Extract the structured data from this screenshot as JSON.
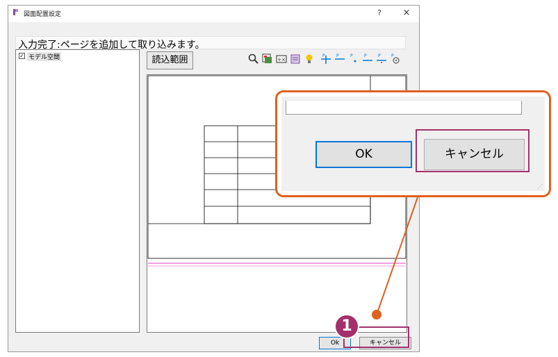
{
  "window": {
    "title": "図面配置設定",
    "help_label": "?",
    "close_label": "×"
  },
  "status": {
    "message": "入力完了:ページを追加して取り込みます。"
  },
  "tree": {
    "items": [
      {
        "label": "モデル空間",
        "checked": true
      }
    ]
  },
  "toolbar": {
    "range_button_label": "読込範囲",
    "icons": [
      "zoom-icon",
      "select-icon",
      "frame-icon",
      "layers-icon",
      "lightbulb-icon",
      "page-add-icon",
      "page-minus-icon",
      "page-point-icon",
      "page-line-icon",
      "page-dotline-icon",
      "page-circle-icon"
    ]
  },
  "footer": {
    "ok_label": "Ok",
    "cancel_label": "キャンセル"
  },
  "zoom": {
    "ok_label": "OK",
    "cancel_label": "キャンセル"
  },
  "annotation": {
    "step_number": "1"
  },
  "colors": {
    "accent_orange": "#e0601f",
    "highlight_magenta": "#a3306a",
    "focus_blue": "#0078d7",
    "preview_pink_line": "#e040c0"
  }
}
